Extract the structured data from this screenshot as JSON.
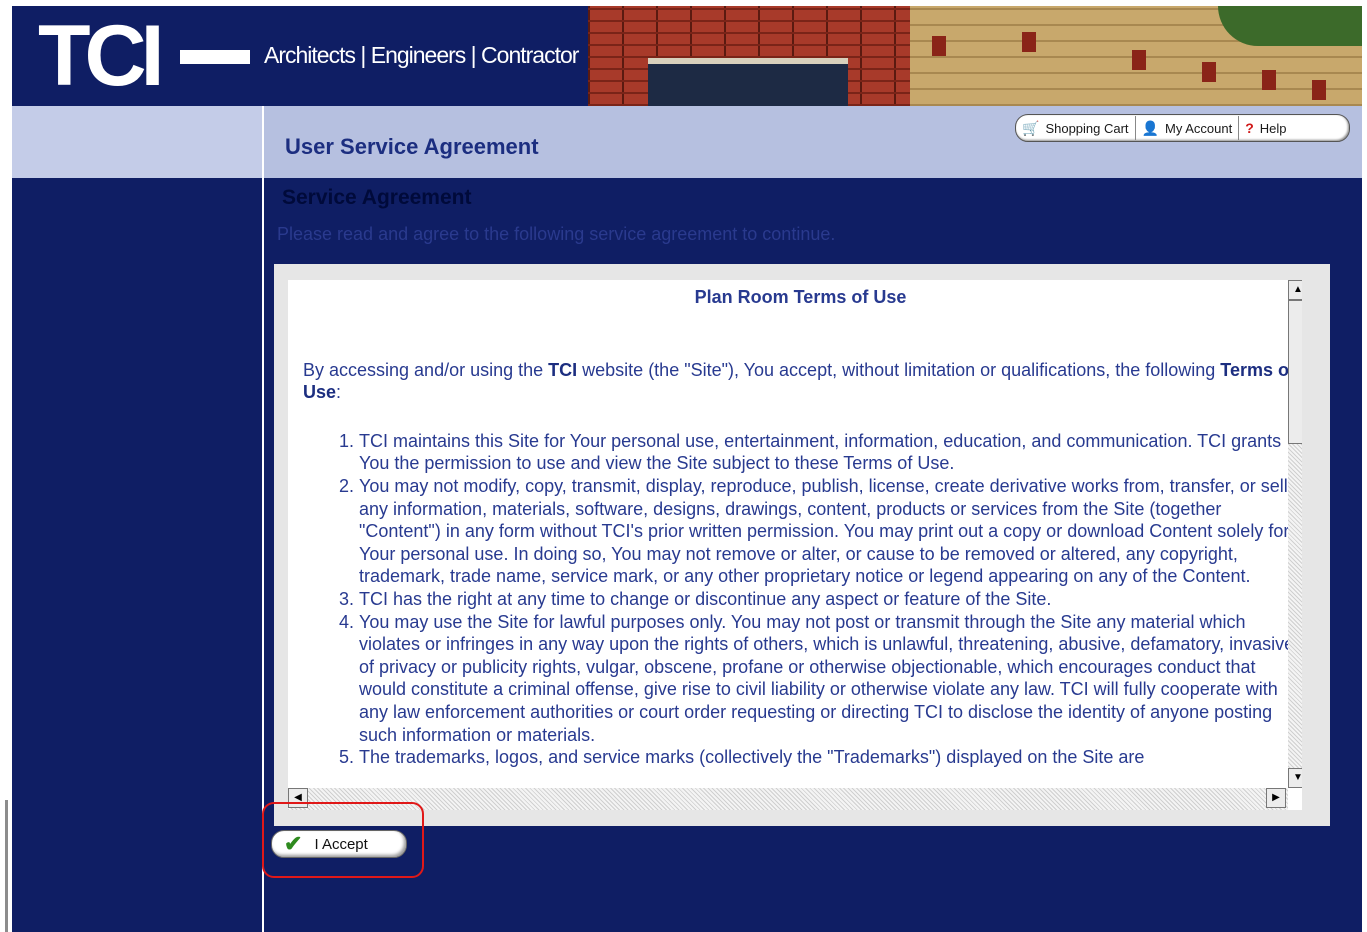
{
  "header": {
    "logo_text": "TCI",
    "tagline": "Architects | Engineers | Contractor"
  },
  "toolbar": {
    "items": [
      {
        "label": "Shopping Cart",
        "icon": "cart-icon"
      },
      {
        "label": "My Account",
        "icon": "user-icon"
      },
      {
        "label": "Help",
        "icon": "help-icon"
      }
    ]
  },
  "page": {
    "title": "User Service Agreement",
    "section_title": "Service Agreement",
    "instruction": "Please read and agree to the following service agreement to continue."
  },
  "terms": {
    "title": "Plan Room Terms of Use",
    "intro_before": "By accessing and/or using the ",
    "intro_brand": "TCI",
    "intro_middle": " website (the \"Site\"), You accept, without limitation or qualifications, the following ",
    "intro_terms": "Terms of Use",
    "intro_after": ":",
    "items": [
      "TCI maintains this Site for Your personal use, entertainment, information, education, and communication. TCI grants You the permission to use and view the Site subject to these Terms of Use.",
      "You may not modify, copy, transmit, display, reproduce, publish, license, create derivative works from, transfer, or sell any information, materials, software, designs, drawings, content, products or services from the Site (together \"Content\") in any form without TCI's prior written permission. You may print out a copy or download Content solely for Your personal use. In doing so, You may not remove or alter, or cause to be removed or altered, any copyright, trademark, trade name, service mark, or any other proprietary notice or legend appearing on any of the Content.",
      "TCI has the right at any time to change or discontinue any aspect or feature of the Site.",
      "You may use the Site for lawful purposes only. You may not post or transmit through the Site any material which violates or infringes in any way upon the rights of others, which is unlawful, threatening, abusive, defamatory, invasive of privacy or publicity rights, vulgar, obscene, profane or otherwise objectionable, which encourages conduct that would constitute a criminal offense, give rise to civil liability or otherwise violate any law. TCI will fully cooperate with any law enforcement authorities or court order requesting or directing TCI to disclose the identity of anyone posting such information or materials.",
      "The trademarks, logos, and service marks (collectively the \"Trademarks\") displayed on the Site are"
    ]
  },
  "accept_button": {
    "label": "I Accept"
  },
  "colors": {
    "background": "#0f1e64",
    "band": "#b6c0e0",
    "title": "#1c2e80",
    "highlight": "#e01818",
    "check": "#2e8a1e"
  }
}
